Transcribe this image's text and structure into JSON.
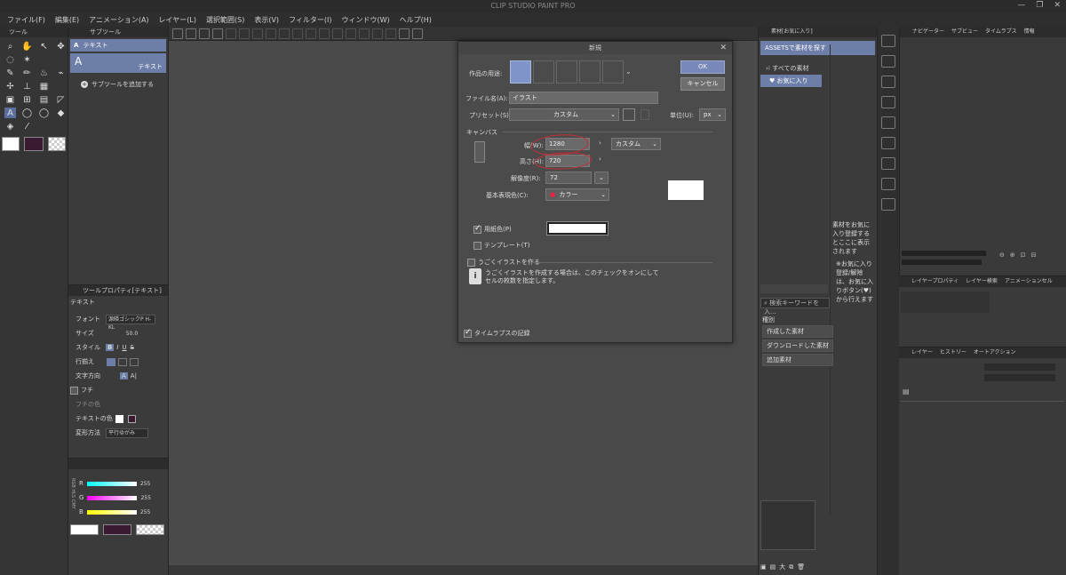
{
  "app": {
    "title": "CLIP STUDIO PAINT PRO",
    "window_buttons": [
      "—",
      "❐",
      "✕"
    ]
  },
  "menu": [
    "ファイル(F)",
    "編集(E)",
    "アニメーション(A)",
    "レイヤー(L)",
    "選択範囲(S)",
    "表示(V)",
    "フィルター(I)",
    "ウィンドウ(W)",
    "ヘルプ(H)"
  ],
  "tool_panel": {
    "tab": "ツール"
  },
  "subtool_panel": {
    "tab": "サブツール",
    "group_label": "テキスト",
    "item_label": "テキスト",
    "add_label": "サブツールを追加する"
  },
  "tool_property": {
    "tab": "ツールプロパティ[テキスト]",
    "tool_name": "テキスト",
    "rows": {
      "font": {
        "label": "フォント",
        "value": "源暎ゴシックP H-KL"
      },
      "size": {
        "label": "サイズ",
        "value": "50.0"
      },
      "style": {
        "label": "スタイル",
        "b": "B",
        "i": "I",
        "u": "U",
        "s": "S"
      },
      "align": {
        "label": "行揃え"
      },
      "direction": {
        "label": "文字方向",
        "horizontal": "A",
        "vertical": "A|"
      },
      "edge": {
        "label": "フチ"
      },
      "edge_color": {
        "label": "フチの色"
      },
      "text_color": {
        "label": "テキストの色"
      },
      "transform": {
        "label": "変形方法",
        "value": "平行ゆがみ"
      }
    }
  },
  "color_slider": {
    "side_labels": [
      "RGB",
      "HLS",
      "CMY"
    ],
    "rows": [
      {
        "label": "R",
        "value": "255"
      },
      {
        "label": "G",
        "value": "255"
      },
      {
        "label": "B",
        "value": "255"
      }
    ]
  },
  "colors": {
    "main": "#ffffff",
    "sub": "#3a1a30",
    "accent": "#6d7fa8",
    "annotation_circle": "#c0303a"
  },
  "dialog": {
    "title": "新規",
    "purpose_label": "作品の用途:",
    "ok": "OK",
    "cancel": "キャンセル",
    "filename_label": "ファイル名(A):",
    "filename_value": "イラスト",
    "preset_label": "プリセット(S):",
    "preset_value": "カスタム",
    "unit_label": "単位(U):",
    "unit_value": "px",
    "canvas_section": "キャンバス",
    "width_label": "幅(W):",
    "width_value": "1280",
    "height_label": "高さ(H):",
    "height_value": "720",
    "size_preset_value": "カスタム",
    "resolution_label": "解像度(R):",
    "resolution_value": "72",
    "color_mode_label": "基本表現色(C):",
    "color_mode_value": "カラー",
    "paper_color_label": "用紙色(P)",
    "paper_color_checked": true,
    "template_label": "テンプレート(T)",
    "template_checked": false,
    "animated_label": "うごくイラストを作る",
    "animated_checked": false,
    "info_text_1": "うごくイラストを作成する場合は、このチェックをオンにして",
    "info_text_2": "セルの枚数を指定します。",
    "timelapse_label": "タイムラプスの記録",
    "timelapse_checked": true
  },
  "material_panel": {
    "tab": "素材[お気に入り]",
    "assets_button": "ASSETSで素材を探す",
    "tree": [
      {
        "label": "すべての素材"
      },
      {
        "label": "お気に入り"
      }
    ],
    "empty_message": "素材をお気に入り登録するとここに表示されます",
    "hint_message": "※お気に入り登録/解除は、お気に入りボタン(♥)から行えます",
    "search_placeholder": "検索キーワードを入...",
    "kind_label": "種別",
    "kind_buttons": [
      "作成した素材",
      "ダウンロードした素材",
      "追加素材"
    ],
    "zoom_label": "大"
  },
  "right_panel": {
    "nav_tabs": [
      "ナビゲーター",
      "サブビュー",
      "タイムラプス",
      "情報"
    ],
    "layer_prop_tabs": [
      "レイヤープロパティ",
      "レイヤー検索",
      "アニメーションセル"
    ],
    "layer_tabs": [
      "レイヤー",
      "ヒストリー",
      "オートアクション"
    ]
  }
}
